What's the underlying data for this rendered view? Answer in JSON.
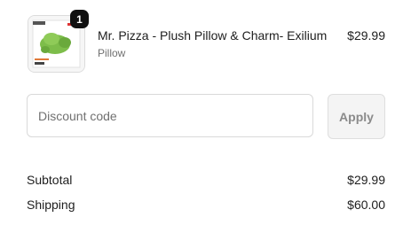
{
  "product": {
    "name": "Mr. Pizza - Plush Pillow & Charm- Exilium",
    "variant": "Pillow",
    "price": "$29.99",
    "quantity": "1"
  },
  "discount": {
    "placeholder": "Discount code",
    "apply_label": "Apply"
  },
  "summary": {
    "subtotal_label": "Subtotal",
    "subtotal_value": "$29.99",
    "shipping_label": "Shipping",
    "shipping_value": "$60.00"
  },
  "colors": {
    "badge_bg": "#111111",
    "apply_bg": "#f4f4f4",
    "plush_green": "#7dbd4a"
  }
}
